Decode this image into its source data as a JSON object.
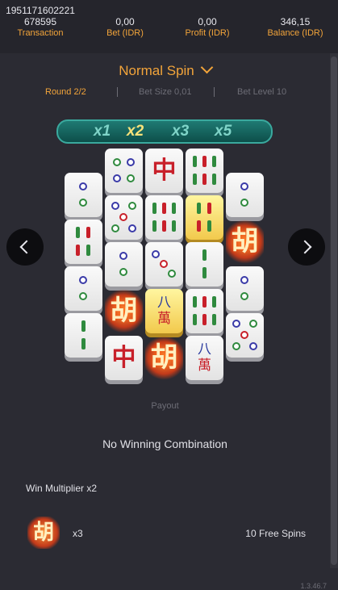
{
  "header": {
    "transaction_id_line1": "1951171602221",
    "transaction_id_line2": "678595",
    "transaction_label": "Transaction",
    "bet_value": "0,00",
    "bet_label": "Bet (IDR)",
    "profit_value": "0,00",
    "profit_label": "Profit (IDR)",
    "balance_value": "346,15",
    "balance_label": "Balance (IDR)"
  },
  "spin": {
    "mode": "Normal Spin",
    "round": "Round 2/2",
    "bet_size": "Bet Size 0,01",
    "bet_level": "Bet Level 10"
  },
  "multipliers": [
    "x1",
    "x2",
    "x3",
    "x5"
  ],
  "active_multiplier": "x2",
  "board_tiles": {
    "zhong": "中",
    "hu": "胡",
    "wan_top": "八",
    "wan_bottom": "萬"
  },
  "payout": {
    "label": "Payout",
    "result": "No Winning Combination",
    "win_multiplier": "Win Multiplier x2",
    "symbol": "胡",
    "symbol_count": "x3",
    "free_spins": "10 Free Spins"
  },
  "version": "1.3.46.7",
  "colors": {
    "accent": "#f2a43a",
    "background": "#2b2b33"
  }
}
